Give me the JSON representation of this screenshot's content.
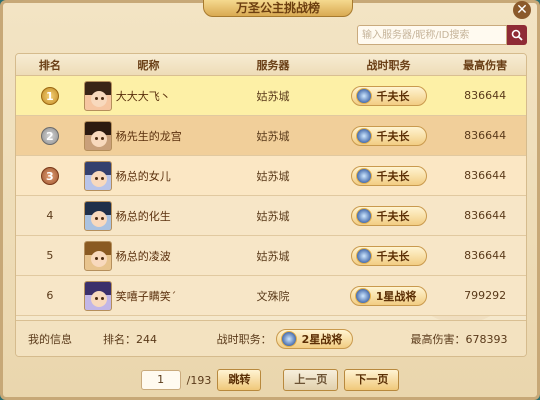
{
  "window": {
    "title": "万圣公主挑战榜",
    "close_icon": "close-icon"
  },
  "search": {
    "placeholder": "输入服务器/昵称/ID搜索",
    "icon": "search-icon"
  },
  "table": {
    "headers": {
      "rank": "排名",
      "name": "昵称",
      "server": "服务器",
      "title": "战时职务",
      "damage": "最高伤害"
    },
    "rows": [
      {
        "rank": "1",
        "name": "大大大飞丶",
        "server": "姑苏城",
        "title": "千夫长",
        "damage": "836644"
      },
      {
        "rank": "2",
        "name": "杨先生的龙宫",
        "server": "姑苏城",
        "title": "千夫长",
        "damage": "836644"
      },
      {
        "rank": "3",
        "name": "杨总的女儿",
        "server": "姑苏城",
        "title": "千夫长",
        "damage": "836644"
      },
      {
        "rank": "4",
        "name": "杨总的化生",
        "server": "姑苏城",
        "title": "千夫长",
        "damage": "836644"
      },
      {
        "rank": "5",
        "name": "杨总的凌波",
        "server": "姑苏城",
        "title": "千夫长",
        "damage": "836644"
      },
      {
        "rank": "6",
        "name": "笑嘻子瞒笑´",
        "server": "文殊院",
        "title": "1星战将",
        "damage": "799292"
      }
    ]
  },
  "my_info": {
    "label": "我的信息",
    "rank": "排名：244",
    "title_label": "战时职务：",
    "title": "2星战将",
    "damage": "最高伤害：678393"
  },
  "pager": {
    "current": "1",
    "total": "/193",
    "jump": "跳转",
    "prev": "上一页",
    "next": "下一页"
  },
  "colors": {
    "accent": "#8f2b36",
    "row_first": "#fdf0a6",
    "row_second": "#f1cf9a"
  }
}
